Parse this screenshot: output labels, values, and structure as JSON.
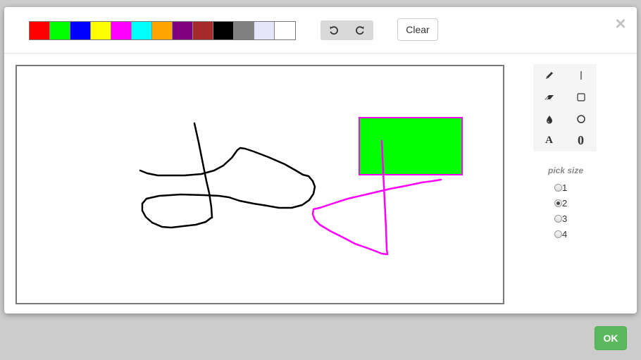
{
  "palette": {
    "colors": [
      "#ff0000",
      "#00ff00",
      "#0000ff",
      "#ffff00",
      "#ff00ff",
      "#00ffff",
      "#ffa500",
      "#800080",
      "#a52a2a",
      "#000000",
      "#808080",
      "#e6e6fa",
      "#ffffff"
    ]
  },
  "toolbar": {
    "undo_icon": "undo-icon",
    "redo_icon": "redo-icon",
    "clear_label": "Clear",
    "close_label": "×"
  },
  "tools": {
    "items": [
      {
        "name": "pencil",
        "icon": "pencil-icon"
      },
      {
        "name": "line",
        "icon": "line-icon"
      },
      {
        "name": "eraser",
        "icon": "eraser-icon"
      },
      {
        "name": "rectangle",
        "icon": "rectangle-icon"
      },
      {
        "name": "fill",
        "icon": "drop-icon"
      },
      {
        "name": "circle",
        "icon": "circle-icon"
      },
      {
        "name": "text",
        "label": "A"
      },
      {
        "name": "number",
        "label": "0"
      }
    ]
  },
  "size": {
    "title": "pick size",
    "options": [
      "1",
      "2",
      "3",
      "4"
    ],
    "selected": "2"
  },
  "footer": {
    "ok_label": "OK"
  },
  "colors": {
    "ok_green": "#5cb85c",
    "stroke_black": "#000000",
    "stroke_magenta": "#ff00ff",
    "rect_fill": "#00ff00"
  }
}
